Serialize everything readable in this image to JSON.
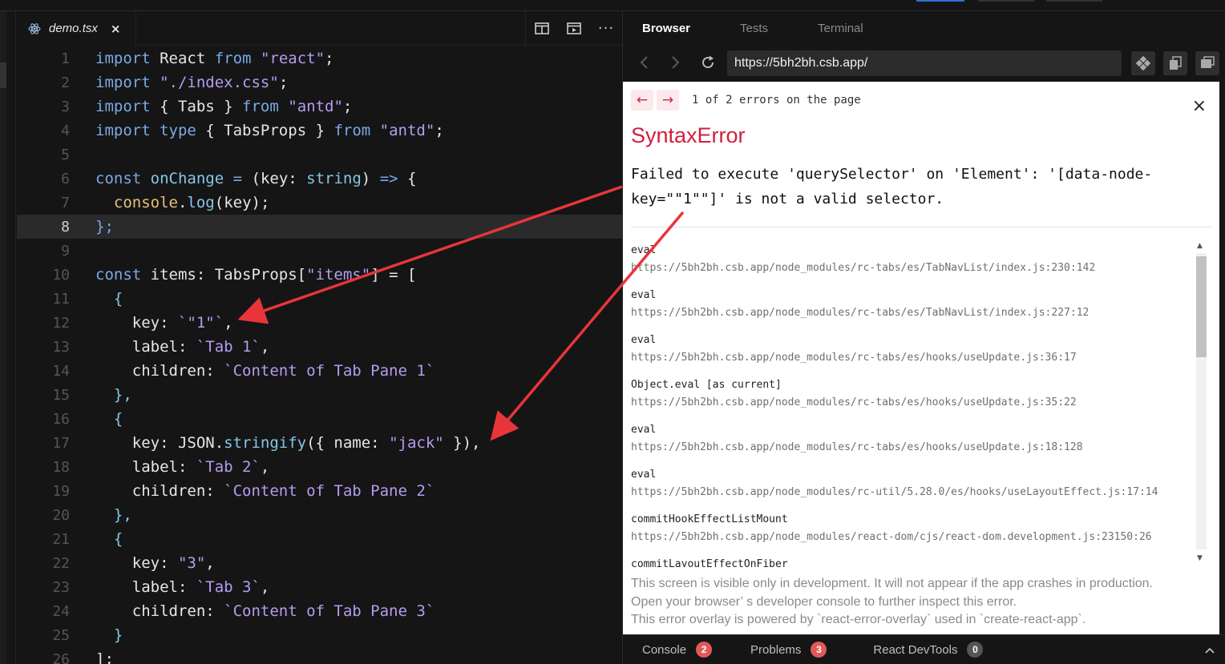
{
  "editor": {
    "file_tab": {
      "name": "demo.tsx",
      "close": "×"
    },
    "toolbar": {
      "more": "···"
    },
    "lines": [
      {
        "n": "1"
      },
      {
        "n": "2"
      },
      {
        "n": "3"
      },
      {
        "n": "4"
      },
      {
        "n": "5"
      },
      {
        "n": "6"
      },
      {
        "n": "7"
      },
      {
        "n": "8"
      },
      {
        "n": "9"
      },
      {
        "n": "10"
      },
      {
        "n": "11"
      },
      {
        "n": "12"
      },
      {
        "n": "13"
      },
      {
        "n": "14"
      },
      {
        "n": "15"
      },
      {
        "n": "16"
      },
      {
        "n": "17"
      },
      {
        "n": "18"
      },
      {
        "n": "19"
      },
      {
        "n": "20"
      },
      {
        "n": "21"
      },
      {
        "n": "22"
      },
      {
        "n": "23"
      },
      {
        "n": "24"
      },
      {
        "n": "25"
      },
      {
        "n": "26"
      }
    ],
    "active_line": "8",
    "code": {
      "l1": {
        "a": "import",
        "b": " React ",
        "c": "from",
        "d": " ",
        "e": "\"react\"",
        "f": ";"
      },
      "l2": {
        "a": "import",
        "b": " ",
        "c": "\"./index.css\"",
        "d": ";"
      },
      "l3": {
        "a": "import",
        "b": " { Tabs } ",
        "c": "from",
        "d": " ",
        "e": "\"antd\"",
        "f": ";"
      },
      "l4": {
        "a": "import",
        "b": " ",
        "c": "type",
        "d": " { TabsProps } ",
        "e": "from",
        "f": " ",
        "g": "\"antd\"",
        "h": ";"
      },
      "l6": {
        "a": "const",
        "b": " ",
        "c": "onChange",
        "d": " ",
        "e": "=",
        "f": " (key: ",
        "g": "string",
        "h": ") ",
        "i": "=>",
        "j": " {"
      },
      "l7": {
        "a": "  ",
        "b": "console",
        "c": ".",
        "d": "log",
        "e": "(key);"
      },
      "l8": {
        "a": "};"
      },
      "l10": {
        "a": "const",
        "b": " items: TabsProps[",
        "c": "\"items\"",
        "d": "] = ["
      },
      "l11": {
        "a": "  {"
      },
      "l12": {
        "a": "    key: ",
        "b": "`\"1\"`",
        "c": ","
      },
      "l13": {
        "a": "    label: ",
        "b": "`Tab 1`",
        "c": ","
      },
      "l14": {
        "a": "    children: ",
        "b": "`Content of Tab Pane 1`"
      },
      "l15": {
        "a": "  },"
      },
      "l16": {
        "a": "  {"
      },
      "l17": {
        "a": "    key: JSON.",
        "b": "stringify",
        "c": "({ name: ",
        "d": "\"jack\"",
        "e": " }),",
        "f": ""
      },
      "l18": {
        "a": "    label: ",
        "b": "`Tab 2`",
        "c": ","
      },
      "l19": {
        "a": "    children: ",
        "b": "`Content of Tab Pane 2`"
      },
      "l20": {
        "a": "  },"
      },
      "l21": {
        "a": "  {"
      },
      "l22": {
        "a": "    key: ",
        "b": "\"3\"",
        "c": ","
      },
      "l23": {
        "a": "    label: ",
        "b": "`Tab 3`",
        "c": ","
      },
      "l24": {
        "a": "    children: ",
        "b": "`Content of Tab Pane 3`"
      },
      "l25": {
        "a": "  }"
      },
      "l26": {
        "a": "];"
      }
    }
  },
  "browser": {
    "tabs": [
      "Browser",
      "Tests",
      "Terminal"
    ],
    "url": "https://5bh2bh.csb.app/",
    "error_overlay": {
      "prev": "←",
      "next": "→",
      "count": "1 of 2 errors on the page",
      "close": "×",
      "title": "SyntaxError",
      "message_line1": "Failed to execute 'querySelector' on 'Element': '[data-node-",
      "message_line2": "key=\"\"1\"\"]' is not a valid selector.",
      "stack": [
        {
          "fn": "eval",
          "loc": "https://5bh2bh.csb.app/node_modules/rc-tabs/es/TabNavList/index.js:230:142"
        },
        {
          "fn": "eval",
          "loc": "https://5bh2bh.csb.app/node_modules/rc-tabs/es/TabNavList/index.js:227:12"
        },
        {
          "fn": "eval",
          "loc": "https://5bh2bh.csb.app/node_modules/rc-tabs/es/hooks/useUpdate.js:36:17"
        },
        {
          "fn": "Object.eval [as current]",
          "loc": "https://5bh2bh.csb.app/node_modules/rc-tabs/es/hooks/useUpdate.js:35:22"
        },
        {
          "fn": "eval",
          "loc": "https://5bh2bh.csb.app/node_modules/rc-tabs/es/hooks/useUpdate.js:18:128"
        },
        {
          "fn": "eval",
          "loc": "https://5bh2bh.csb.app/node_modules/rc-util/5.28.0/es/hooks/useLayoutEffect.js:17:14"
        },
        {
          "fn": "commitHookEffectListMount",
          "loc": "https://5bh2bh.csb.app/node_modules/react-dom/cjs/react-dom.development.js:23150:26"
        },
        {
          "fn": "commitLayoutEffectOnFiber",
          "loc": ""
        }
      ],
      "footnote_1": "This screen is visible only in development. It will not appear if the app crashes in production.",
      "footnote_2": "Open your browser’ s developer console to further inspect this error.",
      "footnote_3": "This error overlay is powered by `react-error-overlay` used in `create-react-app`."
    },
    "bottom": {
      "console_label": "Console",
      "console_count": "2",
      "problems_label": "Problems",
      "problems_count": "3",
      "devtools_label": "React DevTools",
      "devtools_count": "0"
    }
  },
  "colors": {
    "keyword": "#7aa9e8",
    "string": "#b59cf0",
    "error_red": "#d11f3c",
    "annotation_arrow": "#e8353b",
    "badge_red": "#e05a5a",
    "badge_grey": "#555555"
  },
  "icons": [
    "react-icon",
    "close-icon",
    "split-editor-icon",
    "preview-icon",
    "more-icon",
    "back-icon",
    "forward-icon",
    "reload-icon",
    "devtools-icon",
    "copy-icon",
    "window-icon",
    "chevron-up-icon"
  ]
}
